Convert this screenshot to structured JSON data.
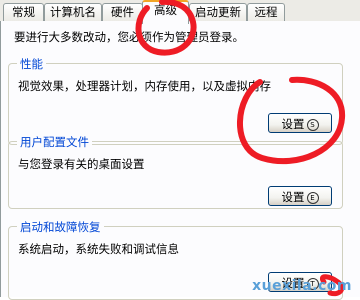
{
  "tabs": [
    {
      "label": "常规"
    },
    {
      "label": "计算机名"
    },
    {
      "label": "硬件"
    },
    {
      "label": "高级",
      "active": true
    },
    {
      "label": "启动更新"
    },
    {
      "label": "远程"
    }
  ],
  "note": "要进行大多数改动，您必须作为管理员登录。",
  "groups": {
    "performance": {
      "title": "性能",
      "desc": "视觉效果，处理器计划，内存使用，以及虚拟内存",
      "button_label": "设置",
      "button_accel": "S"
    },
    "user_profiles": {
      "title": "用户配置文件",
      "desc": "与您登录有关的桌面设置",
      "button_label": "设置",
      "button_accel": "E"
    },
    "startup_recovery": {
      "title": "启动和故障恢复",
      "desc": "系统启动，系统失败和调试信息",
      "button_label": "设置",
      "button_accel": "T"
    }
  },
  "watermark": "xuexila.com",
  "colors": {
    "group_title": "#0046d5",
    "annotation": "#ee1c25",
    "watermark": "#5aa0d8"
  }
}
